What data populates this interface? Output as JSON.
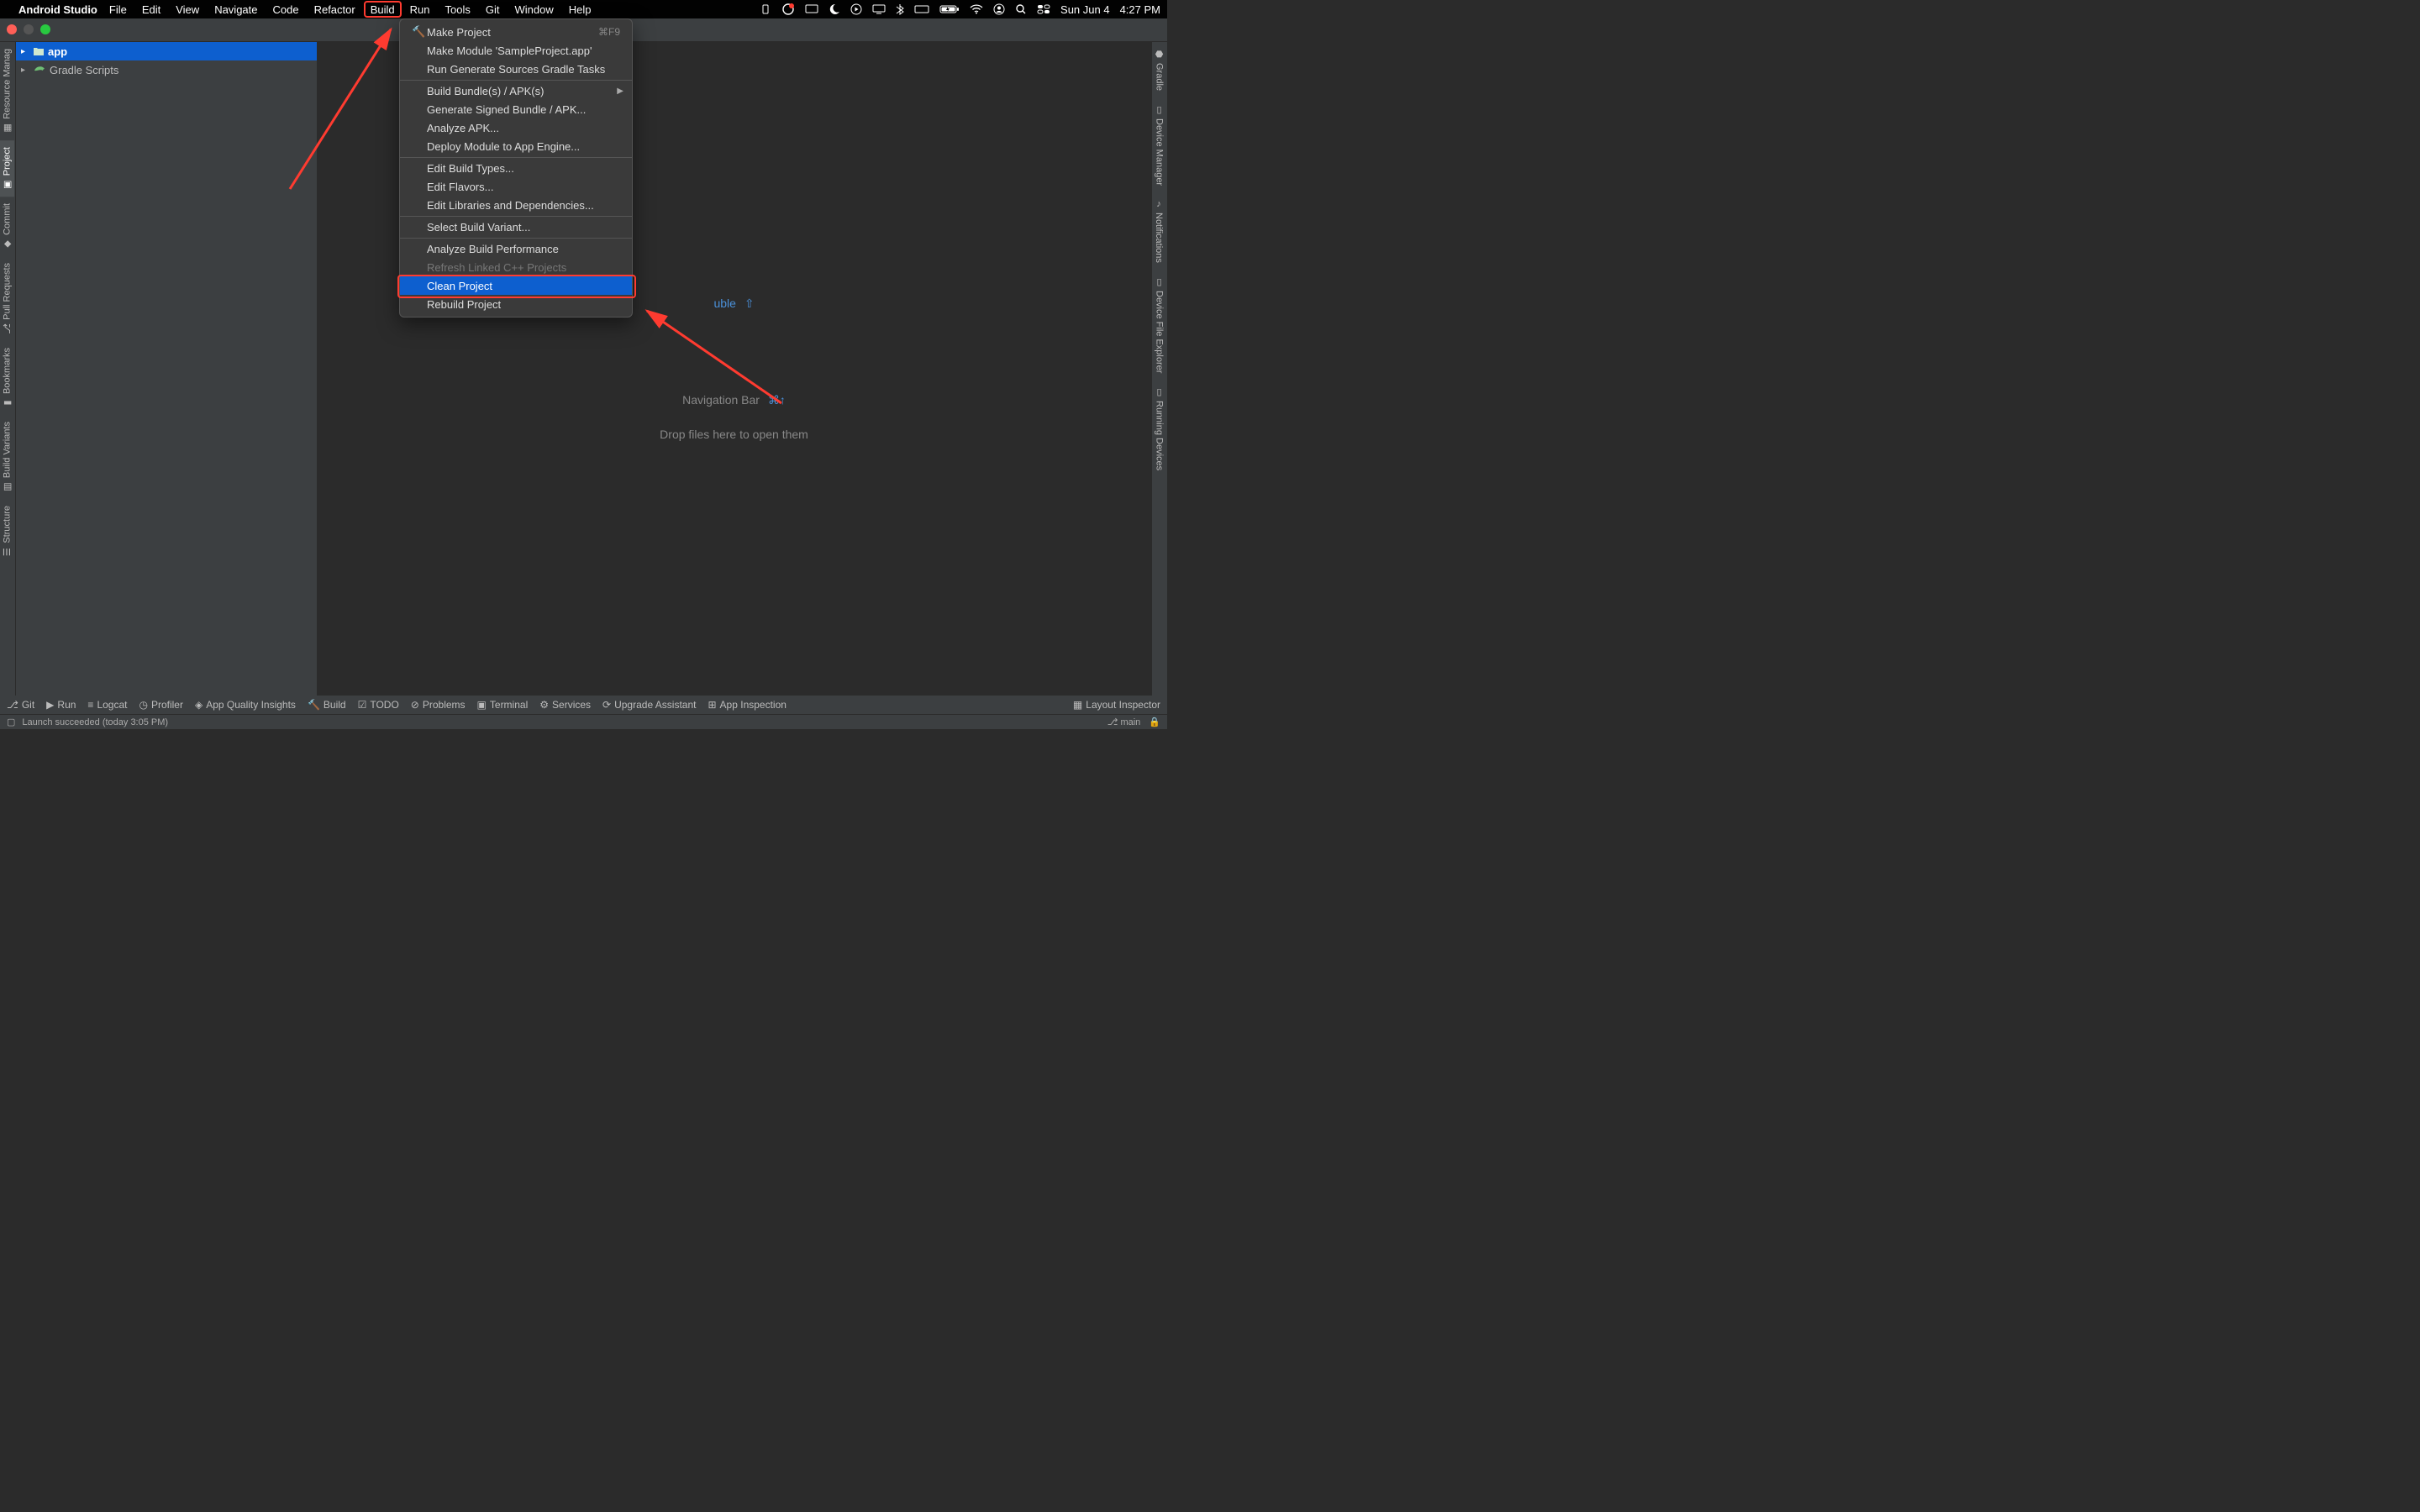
{
  "mac_menu": {
    "app": "Android Studio",
    "items": [
      "File",
      "Edit",
      "View",
      "Navigate",
      "Code",
      "Refactor",
      "Build",
      "Run",
      "Tools",
      "Git",
      "Window",
      "Help"
    ],
    "active_index": 6,
    "date": "Sun Jun 4",
    "time": "4:27 PM"
  },
  "project_tree": {
    "app": "app",
    "gradle": "Gradle Scripts"
  },
  "left_tabs": [
    "Resource Manag",
    "Project",
    "Commit",
    "Pull Requests",
    "Bookmarks",
    "Build Variants",
    "Structure"
  ],
  "right_tabs": [
    "Gradle",
    "Device Manager",
    "Notifications",
    "Device File Explorer",
    "Running Devices"
  ],
  "editor_hints": {
    "hidden_partial": "uble",
    "hidden_sc": "⇧",
    "nav": "Navigation Bar",
    "nav_sc": "⌘↑",
    "drop": "Drop files here to open them"
  },
  "build_menu": {
    "items": [
      {
        "label": "Make Project",
        "icon": "hammer",
        "shortcut": "⌘F9"
      },
      {
        "label": "Make Module 'SampleProject.app'"
      },
      {
        "label": "Run Generate Sources Gradle Tasks"
      },
      {
        "label": "Build Bundle(s) / APK(s)",
        "submenu": true,
        "group": true
      },
      {
        "label": "Generate Signed Bundle / APK..."
      },
      {
        "label": "Analyze APK..."
      },
      {
        "label": "Deploy Module to App Engine..."
      },
      {
        "label": "Edit Build Types...",
        "group": true
      },
      {
        "label": "Edit Flavors..."
      },
      {
        "label": "Edit Libraries and Dependencies..."
      },
      {
        "label": "Select Build Variant...",
        "group": true
      },
      {
        "label": "Analyze Build Performance",
        "group": true
      },
      {
        "label": "Refresh Linked C++ Projects",
        "disabled": true
      },
      {
        "label": "Clean Project",
        "hovered": true
      },
      {
        "label": "Rebuild Project"
      }
    ]
  },
  "bottom_tabs": [
    "Git",
    "Run",
    "Logcat",
    "Profiler",
    "App Quality Insights",
    "Build",
    "TODO",
    "Problems",
    "Terminal",
    "Services",
    "Upgrade Assistant",
    "App Inspection"
  ],
  "bottom_right": "Layout Inspector",
  "status": {
    "launch": "Launch succeeded (today 3:05 PM)",
    "branch": "main"
  }
}
